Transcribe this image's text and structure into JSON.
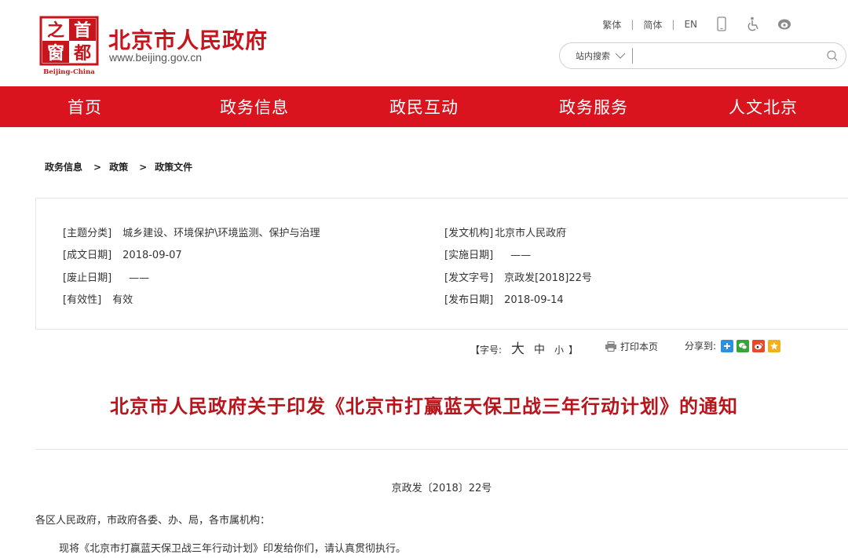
{
  "header": {
    "logo": {
      "chars": [
        "之",
        "首",
        "窗",
        "都"
      ],
      "caption": "Beijing-China"
    },
    "site_title": "北京市人民政府",
    "site_url": "www.beijing.gov.cn",
    "languages": [
      "繁体",
      "简体",
      "EN"
    ],
    "tool_icons": [
      "mobile-icon",
      "accessibility-icon",
      "headphone-icon"
    ],
    "search": {
      "scope_label": "站内搜索",
      "placeholder": ""
    }
  },
  "nav": {
    "items": [
      "首页",
      "政务信息",
      "政民互动",
      "政务服务",
      "人文北京"
    ]
  },
  "breadcrumb": [
    "政务信息",
    "政策",
    "政策文件"
  ],
  "meta": {
    "topic": {
      "label": "[主题分类]",
      "value": "城乡建设、环境保护\\环境监测、保护与治理"
    },
    "issuer": {
      "label": "[发文机构]",
      "value": "北京市人民政府"
    },
    "created": {
      "label": "[成文日期]",
      "value": "2018-09-07"
    },
    "effective": {
      "label": "[实施日期]",
      "value": "——"
    },
    "abolished": {
      "label": "[废止日期]",
      "value": "——"
    },
    "doc_no": {
      "label": "[发文字号]",
      "value": "京政发[2018]22号"
    },
    "validity": {
      "label": "[有效性]",
      "value": "有效"
    },
    "published": {
      "label": "[发布日期]",
      "value": "2018-09-14"
    }
  },
  "tools": {
    "fontsize_prefix": "【字号:",
    "big": "大",
    "mid": "中",
    "small": "小",
    "fontsize_suffix": "】",
    "print": "打印本页",
    "share_label": "分享到:",
    "share_icons": [
      "share-more-icon",
      "wechat-icon",
      "weibo-icon",
      "qzone-icon"
    ],
    "colors": {
      "more": "#2f8fe0",
      "wechat": "#3aa23a",
      "weibo": "#e64a2e",
      "qzone": "#f2b01e"
    }
  },
  "document": {
    "title": "北京市人民政府关于印发《北京市打赢蓝天保卫战三年行动计划》的通知",
    "number": "京政发〔2018〕22号",
    "addressee": "各区人民政府，市政府各委、办、局，各市属机构：",
    "body": "现将《北京市打赢蓝天保卫战三年行动计划》印发给你们，请认真贯彻执行。"
  },
  "colors": {
    "brand_red": "#d9141e",
    "title_red": "#b8141c"
  }
}
